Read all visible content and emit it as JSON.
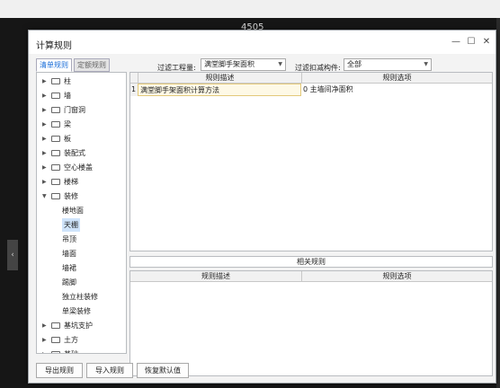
{
  "background": {
    "dimension_text": "4505"
  },
  "dialog": {
    "title": "计算规则",
    "controls": {
      "minimize": "—",
      "maximize": "☐",
      "close": "✕"
    }
  },
  "tabs": [
    {
      "label": "清单规则",
      "active": true
    },
    {
      "label": "定额规则",
      "active": false
    }
  ],
  "filters": {
    "quantity_label": "过滤工程量:",
    "quantity_value": "满堂脚手架面积",
    "deduction_label": "过滤扣减构件:",
    "deduction_value": "全部"
  },
  "tree": [
    {
      "label": "柱",
      "type": "folder",
      "expanded": false
    },
    {
      "label": "墙",
      "type": "folder",
      "expanded": false
    },
    {
      "label": "门窗洞",
      "type": "folder",
      "expanded": false
    },
    {
      "label": "梁",
      "type": "folder",
      "expanded": false
    },
    {
      "label": "板",
      "type": "folder",
      "expanded": false
    },
    {
      "label": "装配式",
      "type": "folder",
      "expanded": false
    },
    {
      "label": "空心楼盖",
      "type": "folder",
      "expanded": false
    },
    {
      "label": "楼梯",
      "type": "folder",
      "expanded": false
    },
    {
      "label": "装修",
      "type": "folder",
      "expanded": true
    },
    {
      "label": "楼地面",
      "type": "child"
    },
    {
      "label": "天棚",
      "type": "child",
      "selected": true
    },
    {
      "label": "吊顶",
      "type": "child"
    },
    {
      "label": "墙面",
      "type": "child"
    },
    {
      "label": "墙裙",
      "type": "child"
    },
    {
      "label": "踢脚",
      "type": "child"
    },
    {
      "label": "独立柱装修",
      "type": "child"
    },
    {
      "label": "单梁装修",
      "type": "child"
    },
    {
      "label": "基坑支护",
      "type": "folder",
      "expanded": false
    },
    {
      "label": "土方",
      "type": "folder",
      "expanded": false
    },
    {
      "label": "基础",
      "type": "folder",
      "expanded": false
    }
  ],
  "rules_grid": {
    "headers": [
      "规则描述",
      "规则选项"
    ],
    "rows": [
      {
        "index": "1",
        "description": "满堂脚手架面积计算方法",
        "option": "0  主墙间净面积"
      }
    ]
  },
  "related_label": "相关规则",
  "related_grid": {
    "headers": [
      "规则描述",
      "规则选项"
    ]
  },
  "buttons": {
    "export": "导出规则",
    "import": "导入规则",
    "restore": "恢复默认值"
  }
}
